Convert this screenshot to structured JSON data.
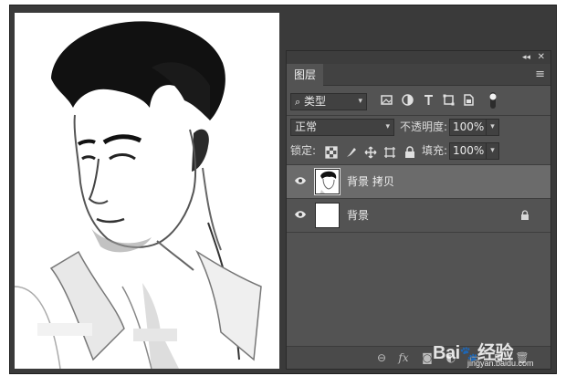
{
  "layers_panel": {
    "tab_label": "图层",
    "filter_kind": "类型",
    "blend_mode": "正常",
    "opacity_label": "不透明度:",
    "opacity_value": "100%",
    "lock_label": "锁定:",
    "fill_label": "填充:",
    "fill_value": "100%",
    "layers": [
      {
        "name": "背景 拷贝",
        "visible": true,
        "selected": true,
        "locked": false
      },
      {
        "name": "背景",
        "visible": true,
        "selected": false,
        "locked": true
      }
    ]
  },
  "watermark": {
    "brand": "Bai",
    "brand_cn": "经验",
    "url": "jingyan.baidu.com"
  },
  "colors": {
    "panel_bg": "#535353",
    "selected_layer_bg": "#6b6b6b",
    "workspace_bg": "#3a3a3a"
  }
}
